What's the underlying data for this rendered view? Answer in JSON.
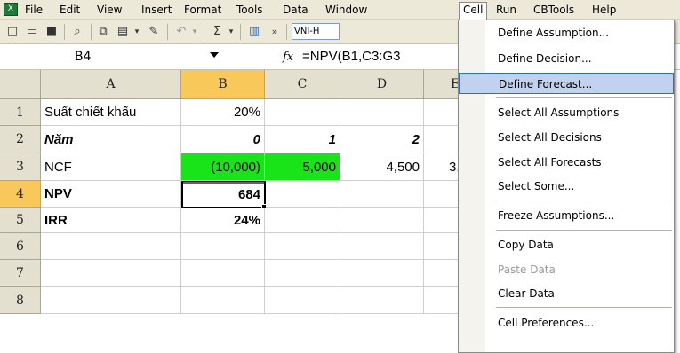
{
  "menubar": {
    "items": [
      "File",
      "Edit",
      "View",
      "Insert",
      "Format",
      "Tools",
      "Data",
      "Window",
      "Cell",
      "Run",
      "CBTools",
      "Help"
    ],
    "active": "Cell"
  },
  "toolbar": {
    "font_name": "VNI-H"
  },
  "formula_bar": {
    "name_box": "B4",
    "fx": "fx",
    "formula": "=NPV(B1,C3:G3"
  },
  "grid": {
    "columns": [
      "A",
      "B",
      "C",
      "D",
      "E"
    ],
    "rows": [
      "1",
      "2",
      "3",
      "4",
      "5",
      "6",
      "7",
      "8"
    ],
    "cells": {
      "A1": "Suất chiết khấu",
      "B1": "20%",
      "A2": "Năm",
      "B2": "0",
      "C2": "1",
      "D2": "2",
      "A3": "NCF",
      "B3": "(10,000)",
      "C3": "5,000",
      "D3": "4,500",
      "E3": "3,",
      "A4": "NPV",
      "B4": "684",
      "A5": "IRR",
      "B5": "24%"
    },
    "selected_cell": "B4",
    "highlight_color": "#18e418"
  },
  "cell_menu": {
    "items": [
      {
        "label": "Define Assumption...",
        "mnemonic_index": 7
      },
      {
        "label": "Define Decision...",
        "mnemonic_index": 7
      },
      {
        "label": "Define Forecast...",
        "mnemonic_index": 7,
        "highlighted": true
      },
      {
        "label": "Select All Assumptions"
      },
      {
        "label": "Select All Decisions"
      },
      {
        "label": "Select All Forecasts"
      },
      {
        "label": "Select Some..."
      },
      {
        "label": "Freeze Assumptions..."
      },
      {
        "label": "Copy Data"
      },
      {
        "label": "Paste Data",
        "disabled": true
      },
      {
        "label": "Clear Data"
      },
      {
        "label": "Cell Preferences..."
      }
    ]
  }
}
